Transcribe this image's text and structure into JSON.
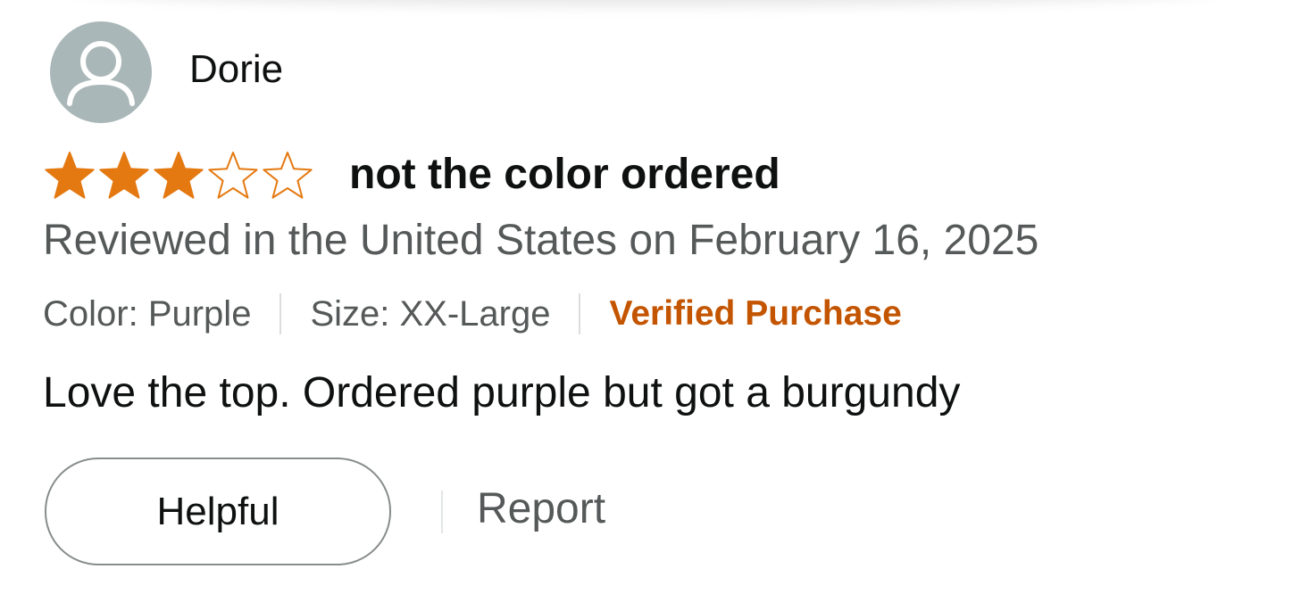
{
  "review": {
    "profile": {
      "name": "Dorie",
      "avatar_icon": "default-user-avatar-icon",
      "avatar_color": "#aab7b8"
    },
    "rating": {
      "stars": 3,
      "max_stars": 5,
      "filled_icon": "star-filled-icon",
      "empty_icon": "star-outline-icon",
      "star_color": "#e47911"
    },
    "title": "not the color ordered",
    "date_text": "Reviewed in the United States on February 16, 2025",
    "variation": {
      "color": "Color: Purple",
      "size": "Size: XX-Large",
      "verified": "Verified Purchase",
      "verified_color": "#c45500"
    },
    "body": "Love the top. Ordered purple but got a burgundy",
    "actions": {
      "helpful_label": "Helpful",
      "report_label": "Report"
    }
  }
}
